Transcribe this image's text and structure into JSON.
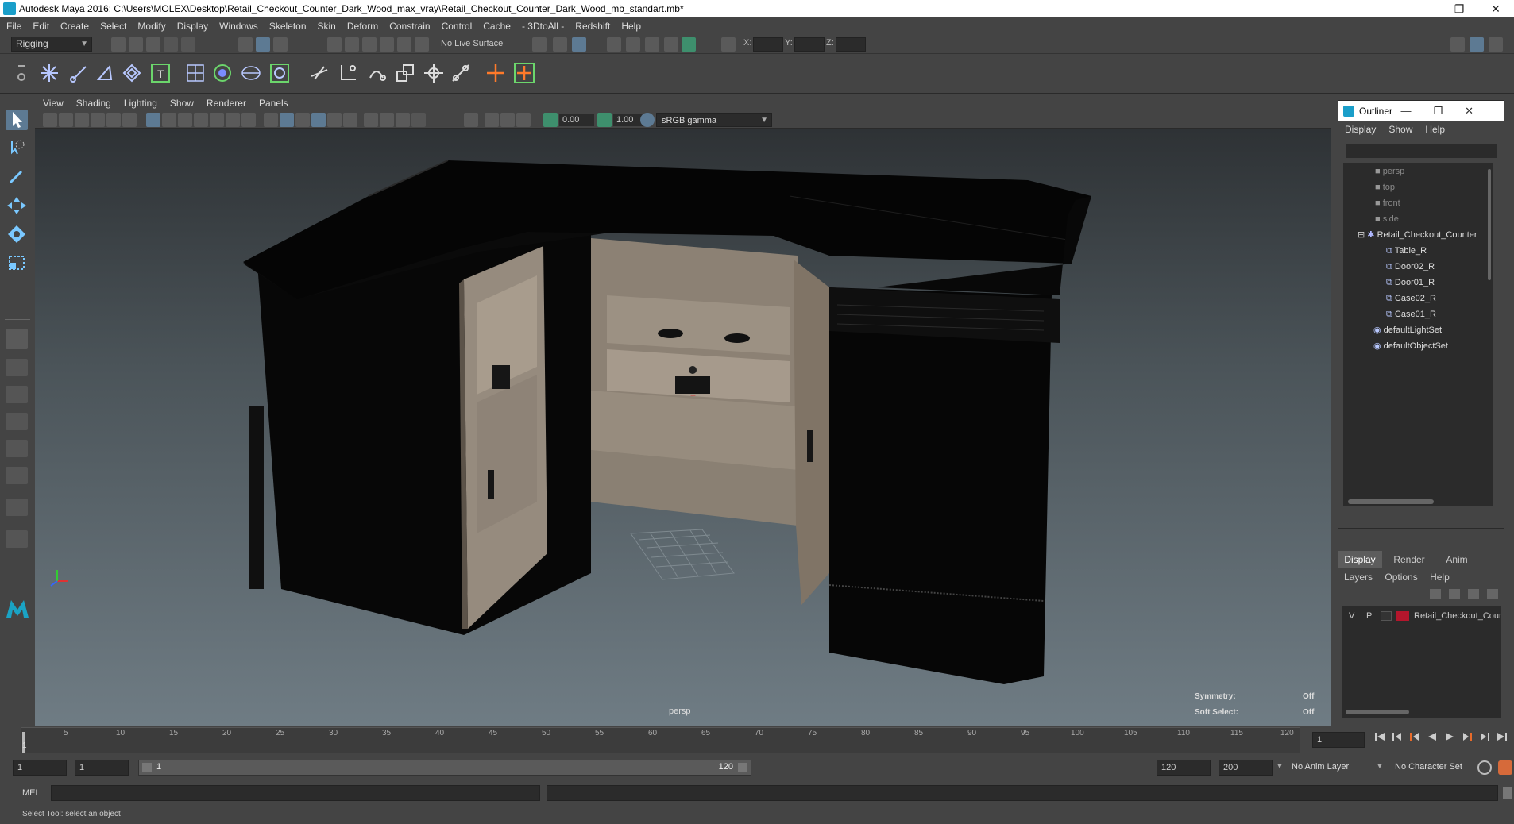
{
  "window": {
    "title": "Autodesk Maya 2016: C:\\Users\\MOLEX\\Desktop\\Retail_Checkout_Counter_Dark_Wood_max_vray\\Retail_Checkout_Counter_Dark_Wood_mb_standart.mb*",
    "controls": [
      "—",
      "❐",
      "✕"
    ]
  },
  "menubar": [
    "File",
    "Edit",
    "Create",
    "Select",
    "Modify",
    "Display",
    "Windows",
    "Skeleton",
    "Skin",
    "Deform",
    "Constrain",
    "Control",
    "Cache",
    "- 3DtoAll -",
    "Redshift",
    "Help"
  ],
  "statusline": {
    "mode": "Rigging",
    "live_surface": "No Live Surface",
    "x_label": "X:",
    "y_label": "Y:",
    "z_label": "Z:"
  },
  "viewport": {
    "menu": [
      "View",
      "Shading",
      "Lighting",
      "Show",
      "Renderer",
      "Panels"
    ],
    "exposure": "0.00",
    "gamma": "1.00",
    "color_space": "sRGB gamma",
    "camera": "persp",
    "symmetry_label": "Symmetry:",
    "symmetry_value": "Off",
    "soft_select_label": "Soft Select:",
    "soft_select_value": "Off"
  },
  "outliner": {
    "title": "Outliner",
    "menu": [
      "Display",
      "Show",
      "Help"
    ],
    "items": [
      "persp",
      "top",
      "front",
      "side",
      "Retail_Checkout_Counter",
      "Table_R",
      "Door02_R",
      "Door01_R",
      "Case02_R",
      "Case01_R",
      "defaultLightSet",
      "defaultObjectSet"
    ]
  },
  "layers": {
    "tabs": [
      "Display",
      "Render",
      "Anim"
    ],
    "menu": [
      "Layers",
      "Options",
      "Help"
    ],
    "layer_v": "V",
    "layer_p": "P",
    "layer_name": "Retail_Checkout_Cour",
    "layer_color": "#b4162c"
  },
  "timeline": {
    "ticks": [
      "1",
      "5",
      "10",
      "15",
      "20",
      "25",
      "30",
      "35",
      "40",
      "45",
      "50",
      "55",
      "60",
      "65",
      "70",
      "75",
      "80",
      "85",
      "90",
      "95",
      "100",
      "105",
      "110",
      "115",
      "120"
    ],
    "current_frame": "1"
  },
  "range": {
    "start": "1",
    "start_inner": "1",
    "slider_start": "1",
    "slider_end": "120",
    "end_inner": "120",
    "end": "200",
    "anim_layer": "No Anim Layer",
    "char_set": "No Character Set"
  },
  "cmd": {
    "lang": "MEL"
  },
  "help_line": "Select Tool: select an object"
}
